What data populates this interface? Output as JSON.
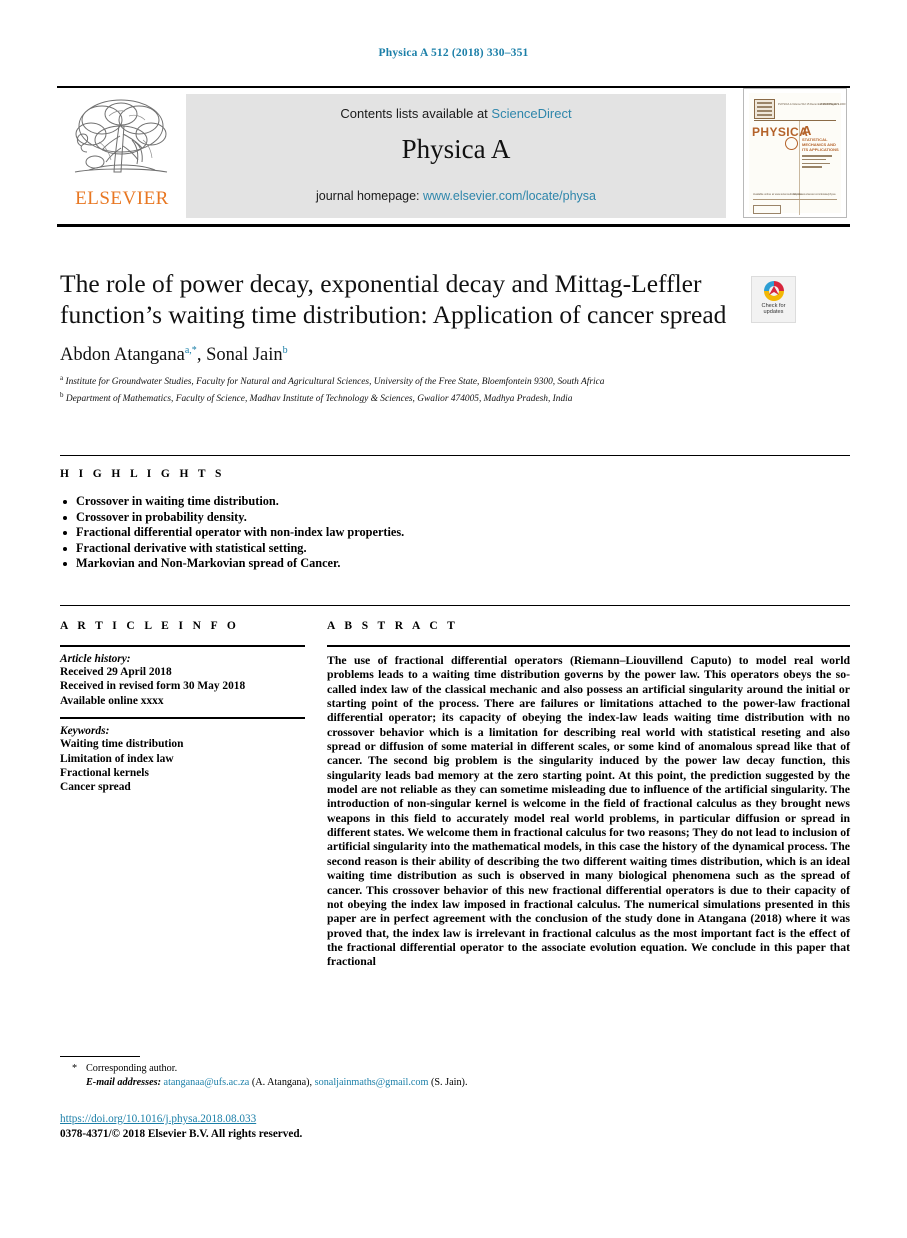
{
  "running_head": "Physica A 512 (2018) 330–351",
  "masthead": {
    "contents_prefix": "Contents lists available at ",
    "contents_link": "ScienceDirect",
    "journal_name": "Physica A",
    "homepage_prefix": "journal homepage: ",
    "homepage_link": "www.elsevier.com/locate/physa",
    "publisher_logo_text": "ELSEVIER",
    "cover": {
      "title": "PHYSICA",
      "letter": "A",
      "subtitle": "STATISTICAL MECHANICS AND ITS APPLICATIONS",
      "header_text": "PHYSICA A  Volume 512  15 December 2018  Pages 1-1000",
      "issn_text": "ISSN 0378-4371",
      "footer_text": "Available online at www.sciencedirect.com",
      "url_text": "http://www.elsevier.com/locate/physa"
    }
  },
  "article": {
    "title": "The role of power decay, exponential decay and Mittag-Leffler function’s waiting time distribution: Application of cancer spread",
    "authors_plain": "Abdon Atangana a,*, Sonal Jain b",
    "authors": [
      {
        "name": "Abdon Atangana",
        "marks": "a,*"
      },
      {
        "name": "Sonal Jain",
        "marks": "b"
      }
    ],
    "affiliations": [
      {
        "mark": "a",
        "text": "Institute for Groundwater Studies, Faculty for Natural and Agricultural Sciences, University of the Free State, Bloemfontein  9300, South Africa"
      },
      {
        "mark": "b",
        "text": "Department of Mathematics, Faculty of Science, Madhav Institute of Technology & Sciences, Gwalior  474005, Madhya Pradesh, India"
      }
    ]
  },
  "crossmark": {
    "line1": "Check for",
    "line2": "updates"
  },
  "highlights": {
    "label": "H I G H L I G H T S",
    "items": [
      "Crossover in waiting time distribution.",
      "Crossover in probability density.",
      "Fractional differential operator with non-index law properties.",
      "Fractional derivative with statistical setting.",
      "Markovian and Non-Markovian spread of Cancer."
    ]
  },
  "article_info": {
    "label": "A R T I C L E    I N F O",
    "history_head": "Article history:",
    "history": [
      "Received 29 April 2018",
      "Received in revised form 30 May 2018",
      "Available online xxxx"
    ],
    "keywords_head": "Keywords:",
    "keywords": [
      "Waiting time distribution",
      "Limitation of index law",
      "Fractional kernels",
      "Cancer spread"
    ]
  },
  "abstract": {
    "label": "A B S T R A C T",
    "text": "The use of fractional differential operators (Riemann–Liouvillend Caputo) to model real world problems leads to a waiting time distribution governs by the power law. This operators obeys the so-called index law of the classical mechanic and also possess an artificial singularity around the initial or starting point of the process. There are failures or limitations attached to the power-law fractional differential operator; its capacity of obeying the index-law leads waiting time distribution with no crossover behavior which is a limitation for describing real world with statistical reseting and also spread or diffusion of some material in different scales, or some kind of anomalous spread like that of cancer. The second big problem is the singularity induced by the power law decay function, this singularity leads bad memory at the zero starting point. At this point, the prediction suggested by the model are not reliable as they can sometime misleading due to influence of the artificial singularity. The introduction of non-singular kernel is welcome in the field of fractional calculus as they brought news weapons in this field to accurately model real world problems, in particular diffusion or spread in different states. We welcome them in fractional calculus for two reasons; They do not lead to inclusion of artificial singularity into the mathematical models, in this case the history of the dynamical process. The second reason is their ability of describing the two different waiting times distribution, which is an ideal waiting time distribution as such is observed in many biological phenomena such as the spread of cancer. This crossover behavior of this new fractional differential operators is due to their capacity of not obeying the index law imposed in fractional calculus. The numerical simulations presented in this paper are in perfect agreement with the conclusion of the study done in Atangana (2018) where it was proved that, the index law is irrelevant in fractional calculus as the most important fact is the effect of the fractional differential operator to the associate evolution equation. We conclude in this paper that fractional"
  },
  "footer": {
    "corresponding_marker": "*",
    "corresponding_text": "Corresponding author.",
    "email_label": "E-mail addresses:",
    "emails": [
      {
        "address": "atanganaa@ufs.ac.za",
        "owner": " (A. Atangana), "
      },
      {
        "address": "sonaljainmaths@gmail.com",
        "owner": " (S. Jain)."
      }
    ],
    "doi": "https://doi.org/10.1016/j.physa.2018.08.033",
    "copyright": "0378-4371/© 2018 Elsevier B.V. All rights reserved."
  },
  "colors": {
    "link": "#1b7fa8",
    "sciencedirect": "#2e86ab",
    "elsevier_orange": "#E87722",
    "cover_brown": "#b4622a"
  }
}
